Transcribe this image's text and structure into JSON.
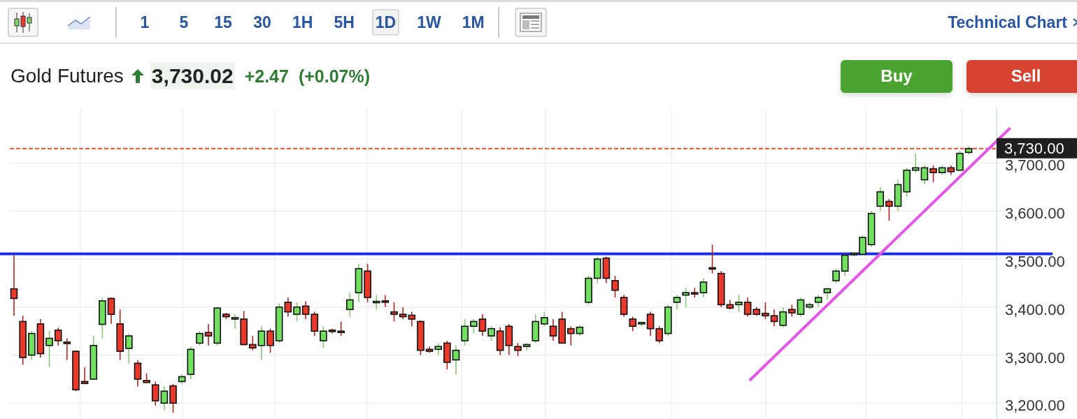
{
  "toolbar": {
    "chart_types": [
      {
        "kind": "candles",
        "selected": true
      },
      {
        "kind": "line",
        "selected": false
      }
    ],
    "intervals": [
      {
        "label": "1",
        "selected": false
      },
      {
        "label": "5",
        "selected": false
      },
      {
        "label": "15",
        "selected": false
      },
      {
        "label": "30",
        "selected": false
      },
      {
        "label": "1H",
        "selected": false
      },
      {
        "label": "5H",
        "selected": false
      },
      {
        "label": "1D",
        "selected": true
      },
      {
        "label": "1W",
        "selected": false
      },
      {
        "label": "1M",
        "selected": false
      }
    ],
    "link": "Technical Chart"
  },
  "instrument": {
    "name": "Gold Futures",
    "rising": true,
    "price": "3,730.02",
    "change": "+2.47",
    "change_percent": "(+0.07%)"
  },
  "actions": [
    {
      "kind": "buy",
      "label": "Buy"
    },
    {
      "kind": "sell",
      "label": "Sell"
    }
  ],
  "chart": {
    "chart_data": {
      "type": "candlestick",
      "ylim": [
        3167,
        3814
      ],
      "grid": true,
      "yticks": [
        {
          "value": 3700,
          "label": "3,700.00"
        },
        {
          "value": 3600,
          "label": "3,600.00"
        },
        {
          "value": 3500,
          "label": "3,500.00"
        },
        {
          "value": 3400,
          "label": "3,400.00"
        },
        {
          "value": 3300,
          "label": "3,300.00"
        },
        {
          "value": 3200,
          "label": "3,200.00"
        }
      ],
      "ohlc": [
        [
          3438,
          3508,
          3382,
          3418
        ],
        [
          3370,
          3382,
          3280,
          3295
        ],
        [
          3300,
          3350,
          3290,
          3345
        ],
        [
          3365,
          3375,
          3295,
          3303
        ],
        [
          3320,
          3350,
          3275,
          3335
        ],
        [
          3352,
          3357,
          3320,
          3330
        ],
        [
          3327,
          3335,
          3290,
          3325
        ],
        [
          3308,
          3310,
          3225,
          3228
        ],
        [
          3245,
          3275,
          3240,
          3241
        ],
        [
          3250,
          3340,
          3248,
          3320
        ],
        [
          3364,
          3420,
          3335,
          3413
        ],
        [
          3418,
          3420,
          3365,
          3385
        ],
        [
          3365,
          3395,
          3290,
          3308
        ],
        [
          3314,
          3345,
          3282,
          3340
        ],
        [
          3283,
          3290,
          3235,
          3250
        ],
        [
          3247,
          3262,
          3242,
          3243
        ],
        [
          3238,
          3245,
          3195,
          3205
        ],
        [
          3200,
          3235,
          3185,
          3225
        ],
        [
          3236,
          3240,
          3180,
          3200
        ],
        [
          3245,
          3260,
          3240,
          3255
        ],
        [
          3260,
          3318,
          3250,
          3312
        ],
        [
          3325,
          3350,
          3320,
          3345
        ],
        [
          3347,
          3365,
          3320,
          3340
        ],
        [
          3325,
          3400,
          3320,
          3398
        ],
        [
          3385,
          3388,
          3375,
          3380
        ],
        [
          3375,
          3385,
          3355,
          3378
        ],
        [
          3375,
          3392,
          3320,
          3322
        ],
        [
          3322,
          3340,
          3310,
          3315
        ],
        [
          3320,
          3360,
          3290,
          3350
        ],
        [
          3350,
          3355,
          3305,
          3320
        ],
        [
          3330,
          3408,
          3325,
          3400
        ],
        [
          3410,
          3420,
          3380,
          3390
        ],
        [
          3385,
          3410,
          3370,
          3400
        ],
        [
          3402,
          3412,
          3375,
          3385
        ],
        [
          3385,
          3390,
          3340,
          3350
        ],
        [
          3330,
          3360,
          3315,
          3350
        ],
        [
          3352,
          3355,
          3345,
          3350
        ],
        [
          3350,
          3370,
          3340,
          3348
        ],
        [
          3395,
          3430,
          3380,
          3415
        ],
        [
          3430,
          3490,
          3410,
          3480
        ],
        [
          3475,
          3490,
          3410,
          3420
        ],
        [
          3410,
          3425,
          3395,
          3412
        ],
        [
          3413,
          3425,
          3400,
          3410
        ],
        [
          3390,
          3410,
          3370,
          3385
        ],
        [
          3385,
          3400,
          3375,
          3380
        ],
        [
          3383,
          3390,
          3360,
          3375
        ],
        [
          3370,
          3372,
          3300,
          3310
        ],
        [
          3312,
          3318,
          3305,
          3308
        ],
        [
          3312,
          3325,
          3300,
          3318
        ],
        [
          3325,
          3330,
          3270,
          3285
        ],
        [
          3290,
          3320,
          3260,
          3310
        ],
        [
          3330,
          3375,
          3320,
          3360
        ],
        [
          3360,
          3375,
          3345,
          3370
        ],
        [
          3375,
          3385,
          3340,
          3350
        ],
        [
          3340,
          3360,
          3330,
          3355
        ],
        [
          3350,
          3358,
          3300,
          3310
        ],
        [
          3360,
          3365,
          3300,
          3320
        ],
        [
          3318,
          3325,
          3298,
          3310
        ],
        [
          3318,
          3325,
          3310,
          3322
        ],
        [
          3330,
          3385,
          3325,
          3370
        ],
        [
          3365,
          3390,
          3360,
          3378
        ],
        [
          3360,
          3375,
          3330,
          3340
        ],
        [
          3375,
          3390,
          3325,
          3325
        ],
        [
          3355,
          3360,
          3320,
          3345
        ],
        [
          3345,
          3362,
          3340,
          3358
        ],
        [
          3410,
          3465,
          3405,
          3460
        ],
        [
          3460,
          3505,
          3450,
          3500
        ],
        [
          3502,
          3505,
          3450,
          3460
        ],
        [
          3455,
          3465,
          3420,
          3435
        ],
        [
          3420,
          3425,
          3380,
          3385
        ],
        [
          3375,
          3380,
          3350,
          3360
        ],
        [
          3365,
          3370,
          3360,
          3368
        ],
        [
          3385,
          3390,
          3340,
          3355
        ],
        [
          3355,
          3360,
          3325,
          3330
        ],
        [
          3345,
          3405,
          3340,
          3400
        ],
        [
          3410,
          3425,
          3395,
          3420
        ],
        [
          3425,
          3440,
          3400,
          3430
        ],
        [
          3430,
          3440,
          3420,
          3428
        ],
        [
          3430,
          3460,
          3420,
          3452
        ],
        [
          3482,
          3530,
          3470,
          3480
        ],
        [
          3470,
          3475,
          3400,
          3405
        ],
        [
          3405,
          3415,
          3395,
          3398
        ],
        [
          3405,
          3425,
          3390,
          3410
        ],
        [
          3410,
          3420,
          3380,
          3385
        ],
        [
          3395,
          3400,
          3382,
          3385
        ],
        [
          3387,
          3410,
          3375,
          3382
        ],
        [
          3382,
          3395,
          3360,
          3370
        ],
        [
          3362,
          3400,
          3358,
          3390
        ],
        [
          3395,
          3405,
          3380,
          3388
        ],
        [
          3385,
          3420,
          3380,
          3415
        ],
        [
          3400,
          3410,
          3395,
          3405
        ],
        [
          3410,
          3425,
          3400,
          3420
        ],
        [
          3430,
          3440,
          3415,
          3438
        ],
        [
          3455,
          3480,
          3450,
          3475
        ],
        [
          3475,
          3510,
          3465,
          3508
        ],
        [
          3510,
          3515,
          3505,
          3512
        ],
        [
          3510,
          3550,
          3508,
          3545
        ],
        [
          3530,
          3600,
          3525,
          3595
        ],
        [
          3610,
          3650,
          3600,
          3640
        ],
        [
          3620,
          3625,
          3580,
          3610
        ],
        [
          3610,
          3665,
          3600,
          3655
        ],
        [
          3640,
          3690,
          3630,
          3685
        ],
        [
          3685,
          3720,
          3680,
          3690
        ],
        [
          3665,
          3695,
          3655,
          3690
        ],
        [
          3688,
          3695,
          3660,
          3680
        ],
        [
          3680,
          3695,
          3675,
          3690
        ],
        [
          3690,
          3695,
          3675,
          3682
        ],
        [
          3685,
          3725,
          3683,
          3720
        ],
        [
          3722,
          3735,
          3718,
          3730
        ]
      ],
      "ref_lines": [
        {
          "axis": "y",
          "value": 3730,
          "color": "#e0523c",
          "label": "3,730.00"
        },
        {
          "axis": "y",
          "value": 3511,
          "color": "#1a2ee8"
        }
      ]
    }
  }
}
